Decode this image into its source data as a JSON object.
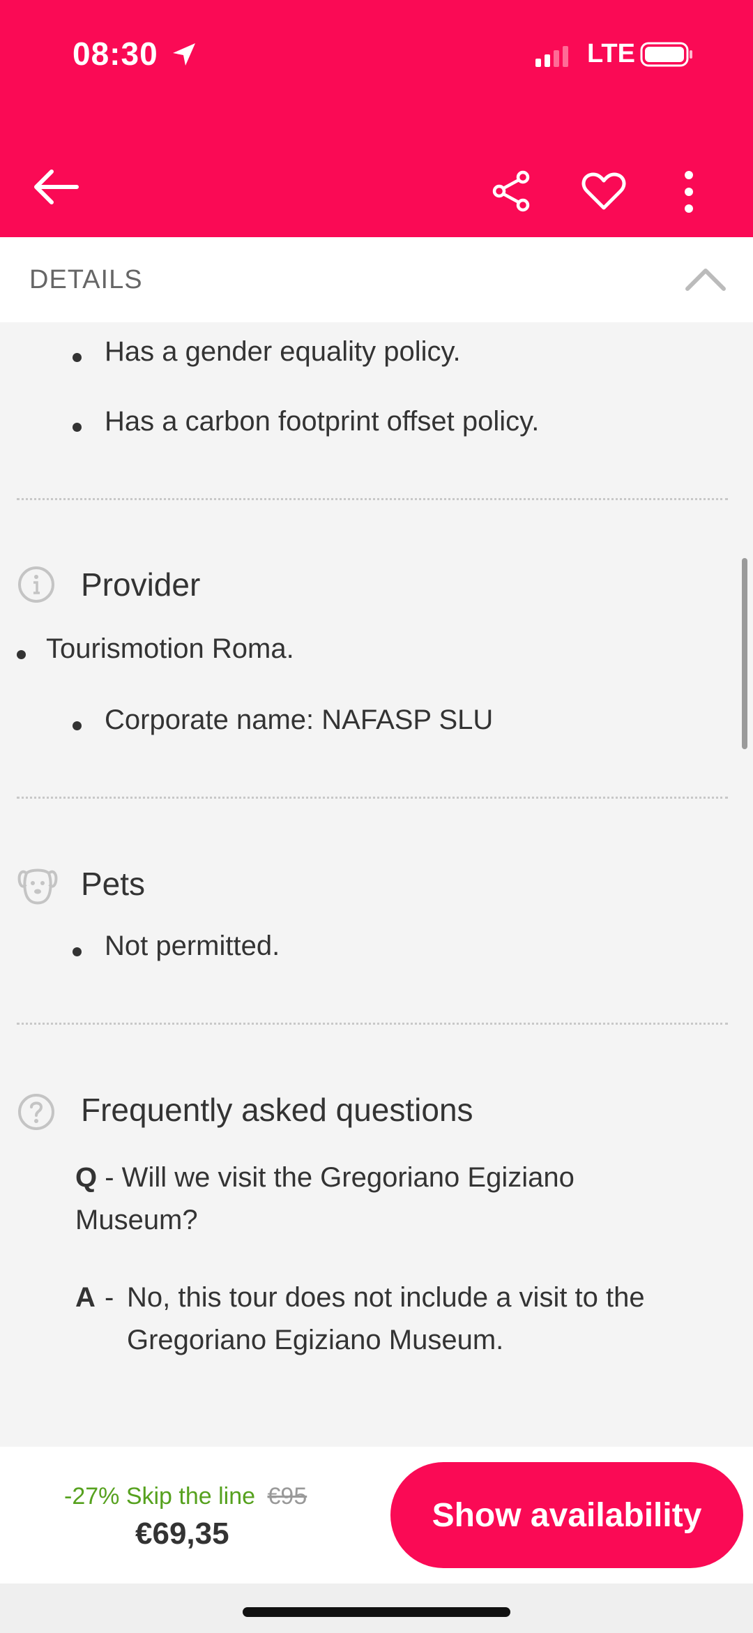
{
  "status_bar": {
    "time": "08:30",
    "network": "LTE",
    "icons": [
      "location-arrow-icon",
      "signal-bars-icon",
      "battery-icon"
    ]
  },
  "app_bar": {
    "icons": [
      "back-arrow-icon",
      "share-icon",
      "heart-icon",
      "more-vertical-icon"
    ]
  },
  "details": {
    "title": "DETAILS",
    "icon": "chevron-up-icon"
  },
  "sustainability": {
    "items": [
      "Has a gender equality policy.",
      "Has a carbon footprint offset policy."
    ]
  },
  "provider": {
    "title": "Provider",
    "icon": "info-circle-icon",
    "name": "Tourismotion Roma.",
    "corporate": "Corporate name: NAFASP SLU"
  },
  "pets": {
    "title": "Pets",
    "icon": "dog-face-icon",
    "items": [
      "Not permitted."
    ]
  },
  "faq": {
    "title": "Frequently asked questions",
    "icon": "question-circle-icon",
    "q_label": "Q",
    "question_line1": "- Will we visit the Gregoriano Egiziano",
    "question_line2": "Museum?",
    "a_label": "A",
    "answer_dash": "-",
    "answer_line1": "No, this tour does not include a visit to the",
    "answer_line2": "Gregoriano Egiziano Museum."
  },
  "booking": {
    "discount": "-27% Skip the line",
    "old_price": "€95",
    "price": "€69,35",
    "cta": "Show availability"
  },
  "colors": {
    "brand": "#fa0a55",
    "discount": "#56a11e",
    "background": "#f4f4f4"
  }
}
